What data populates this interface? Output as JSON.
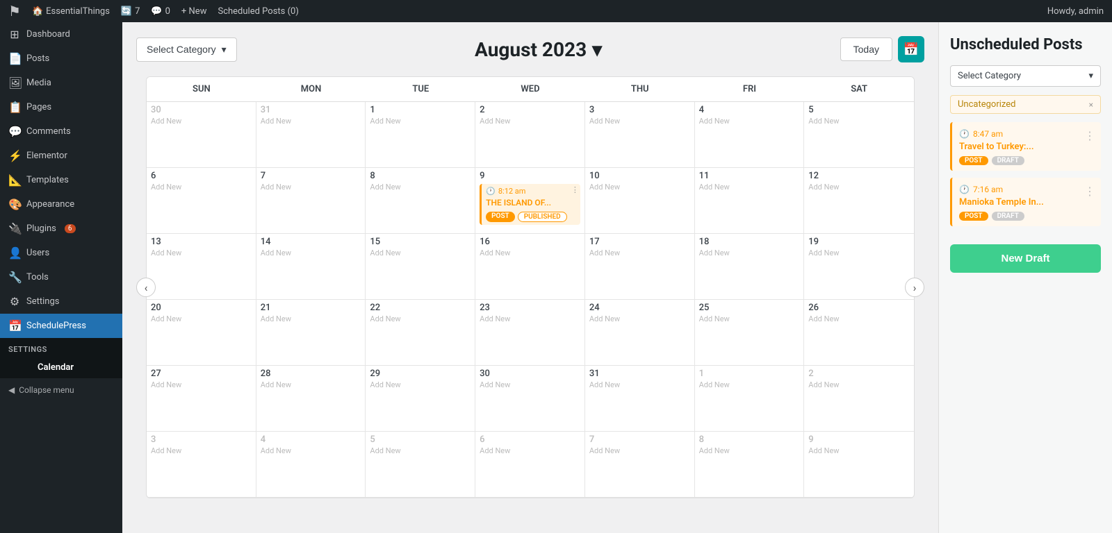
{
  "adminBar": {
    "siteName": "EssentialThings",
    "updates": "7",
    "comments": "0",
    "newLabel": "+ New",
    "scheduledPosts": "Scheduled Posts (0)",
    "user": "Howdy, admin"
  },
  "sidebar": {
    "items": [
      {
        "id": "dashboard",
        "label": "Dashboard",
        "icon": "⊞"
      },
      {
        "id": "posts",
        "label": "Posts",
        "icon": "📄"
      },
      {
        "id": "media",
        "label": "Media",
        "icon": "🖼"
      },
      {
        "id": "pages",
        "label": "Pages",
        "icon": "📋"
      },
      {
        "id": "comments",
        "label": "Comments",
        "icon": "💬"
      },
      {
        "id": "elementor",
        "label": "Elementor",
        "icon": "⚡"
      },
      {
        "id": "templates",
        "label": "Templates",
        "icon": "📐"
      },
      {
        "id": "appearance",
        "label": "Appearance",
        "icon": "🎨"
      },
      {
        "id": "plugins",
        "label": "Plugins",
        "icon": "🔌",
        "badge": "6"
      },
      {
        "id": "users",
        "label": "Users",
        "icon": "👤"
      },
      {
        "id": "tools",
        "label": "Tools",
        "icon": "🔧"
      },
      {
        "id": "settings",
        "label": "Settings",
        "icon": "⚙"
      },
      {
        "id": "schedulepress",
        "label": "SchedulePress",
        "icon": "📅",
        "active": true
      }
    ],
    "submenu": {
      "sectionLabel": "Settings",
      "items": [
        {
          "id": "calendar",
          "label": "Calendar",
          "active": true
        }
      ]
    },
    "collapseLabel": "Collapse menu"
  },
  "calendar": {
    "selectCategoryLabel": "Select Category",
    "monthTitle": "August 2023",
    "todayLabel": "Today",
    "dayHeaders": [
      "SUN",
      "MON",
      "TUE",
      "WED",
      "THU",
      "FRI",
      "SAT"
    ],
    "addNewLabel": "Add New",
    "prevArrow": "‹",
    "nextArrow": "›",
    "chevronDown": "▾",
    "weeks": [
      [
        {
          "num": "30",
          "other": true
        },
        {
          "num": "31",
          "other": true
        },
        {
          "num": "1"
        },
        {
          "num": "2"
        },
        {
          "num": "3"
        },
        {
          "num": "4"
        },
        {
          "num": "5"
        }
      ],
      [
        {
          "num": "6"
        },
        {
          "num": "7"
        },
        {
          "num": "8"
        },
        {
          "num": "9",
          "hasEvent": true
        },
        {
          "num": "10"
        },
        {
          "num": "11"
        },
        {
          "num": "12"
        }
      ],
      [
        {
          "num": "13"
        },
        {
          "num": "14"
        },
        {
          "num": "15"
        },
        {
          "num": "16"
        },
        {
          "num": "17"
        },
        {
          "num": "18"
        },
        {
          "num": "19"
        }
      ],
      [
        {
          "num": "20"
        },
        {
          "num": "21"
        },
        {
          "num": "22"
        },
        {
          "num": "23"
        },
        {
          "num": "24"
        },
        {
          "num": "25"
        },
        {
          "num": "26"
        }
      ],
      [
        {
          "num": "27"
        },
        {
          "num": "28"
        },
        {
          "num": "29"
        },
        {
          "num": "30"
        },
        {
          "num": "31"
        },
        {
          "num": "1",
          "other": true
        },
        {
          "num": "2",
          "other": true
        }
      ],
      [
        {
          "num": "3",
          "other": true
        },
        {
          "num": "4",
          "other": true
        },
        {
          "num": "5",
          "other": true
        },
        {
          "num": "6",
          "other": true
        },
        {
          "num": "7",
          "other": true
        },
        {
          "num": "8",
          "other": true
        },
        {
          "num": "9",
          "other": true
        }
      ]
    ],
    "event": {
      "time": "8:12 am",
      "title": "THE ISLAND OF...",
      "tags": [
        "POST",
        "PUBLISHED"
      ],
      "menuIcon": "⋮"
    }
  },
  "rightPanel": {
    "title": "Unscheduled Posts",
    "selectCategoryLabel": "Select Category",
    "chevronDown": "▾",
    "uncategorizedLabel": "Uncategorized",
    "closeX": "×",
    "posts": [
      {
        "time": "8:47 am",
        "title": "Travel to Turkey:...",
        "tags": [
          "POST",
          "DRAFT"
        ],
        "menuIcon": "⋮"
      },
      {
        "time": "7:16 am",
        "title": "Manioka Temple In...",
        "tags": [
          "POST",
          "DRAFT"
        ],
        "menuIcon": "⋮"
      }
    ],
    "newDraftLabel": "New Draft"
  }
}
